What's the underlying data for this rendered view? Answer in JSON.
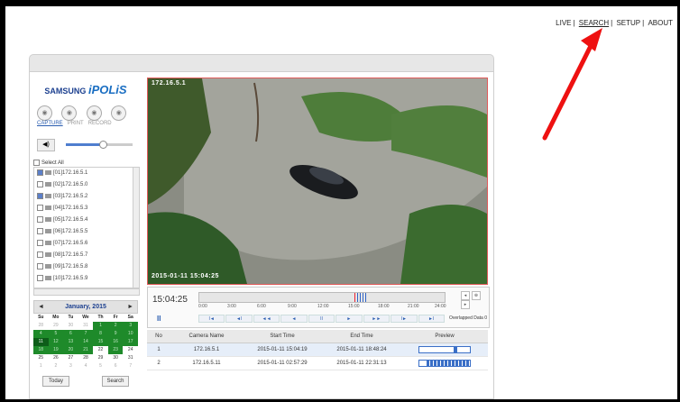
{
  "topnav": {
    "live": "LIVE",
    "search": "SEARCH",
    "setup": "SETUP",
    "about": "ABOUT",
    "sep": "|"
  },
  "logo": {
    "brand": "SAMSUNG",
    "product": "iPOLiS"
  },
  "controls": {
    "labels": [
      "CAPTURE",
      "PRINT",
      "RECORD"
    ]
  },
  "volume": {
    "level": 0.55
  },
  "camlist": {
    "select_all": "Select All",
    "items": [
      {
        "label": "[01]172.16.5.1",
        "checked": true
      },
      {
        "label": "[02]172.16.5.0",
        "checked": false
      },
      {
        "label": "[03]172.16.5.2",
        "checked": true
      },
      {
        "label": "[04]172.16.5.3",
        "checked": false
      },
      {
        "label": "[05]172.16.5.4",
        "checked": false
      },
      {
        "label": "[06]172.16.5.5",
        "checked": false
      },
      {
        "label": "[07]172.16.5.6",
        "checked": false
      },
      {
        "label": "[08]172.16.5.7",
        "checked": false
      },
      {
        "label": "[09]172.16.5.8",
        "checked": false
      },
      {
        "label": "[10]172.16.5.9",
        "checked": false
      }
    ]
  },
  "calendar": {
    "title": "January, 2015",
    "prev": "◄",
    "next": "►",
    "dow": [
      "Su",
      "Mo",
      "Tu",
      "We",
      "Th",
      "Fr",
      "Sa"
    ],
    "days": [
      [
        "28",
        "dim"
      ],
      [
        "29",
        "dim"
      ],
      [
        "30",
        "dim"
      ],
      [
        "31",
        "dim"
      ],
      [
        "1",
        "g"
      ],
      [
        "2",
        "g"
      ],
      [
        "3",
        "g"
      ],
      [
        "4",
        "g"
      ],
      [
        "5",
        "g"
      ],
      [
        "6",
        "g"
      ],
      [
        "7",
        "g"
      ],
      [
        "8",
        "g"
      ],
      [
        "9",
        "g"
      ],
      [
        "10",
        "g"
      ],
      [
        "11",
        "sel"
      ],
      [
        "12",
        "g"
      ],
      [
        "13",
        "g"
      ],
      [
        "14",
        "g"
      ],
      [
        "15",
        "g"
      ],
      [
        "16",
        "g"
      ],
      [
        "17",
        "g"
      ],
      [
        "18",
        "g"
      ],
      [
        "19",
        "g"
      ],
      [
        "20",
        "g"
      ],
      [
        "21",
        "g"
      ],
      [
        "22",
        ""
      ],
      [
        "23",
        "g"
      ],
      [
        "24",
        ""
      ],
      [
        "25",
        ""
      ],
      [
        "26",
        ""
      ],
      [
        "27",
        ""
      ],
      [
        "28",
        ""
      ],
      [
        "29",
        ""
      ],
      [
        "30",
        ""
      ],
      [
        "31",
        ""
      ],
      [
        "1",
        "dim"
      ],
      [
        "2",
        "dim"
      ],
      [
        "3",
        "dim"
      ],
      [
        "4",
        "dim"
      ],
      [
        "5",
        "dim"
      ],
      [
        "6",
        "dim"
      ],
      [
        "7",
        "dim"
      ]
    ],
    "today": "Today",
    "search": "Search"
  },
  "video": {
    "cam_osd": "172.16.5.1",
    "date_osd": "2015-01-11 15:04:25"
  },
  "timeline": {
    "time": "15:04:25",
    "pause": "II",
    "ticks": [
      "0:00",
      "3:00",
      "6:00",
      "9:00",
      "12:00",
      "15:00",
      "18:00",
      "21:00",
      "24:00"
    ],
    "buttons": [
      "I◄",
      "◄I",
      "◄◄",
      "◄",
      "II",
      "►",
      "►►",
      "I►",
      "►I"
    ],
    "overlapped": "Overlapped Data",
    "overlap_value": "0"
  },
  "results": {
    "headers": [
      "No",
      "Camera Name",
      "Start Time",
      "End Time",
      "Preview"
    ],
    "rows": [
      {
        "no": "1",
        "cam": "172.16.5.1",
        "start": "2015-01-11 15:04:19",
        "end": "2015-01-11 18:48:24"
      },
      {
        "no": "2",
        "cam": "172.16.5.11",
        "start": "2015-01-11 02:57:29",
        "end": "2015-01-11 22:31:13"
      }
    ]
  },
  "colors": {
    "accent": "#2a5db0",
    "calendar_green": "#1e8a2a",
    "arrow": "#ee1111"
  }
}
